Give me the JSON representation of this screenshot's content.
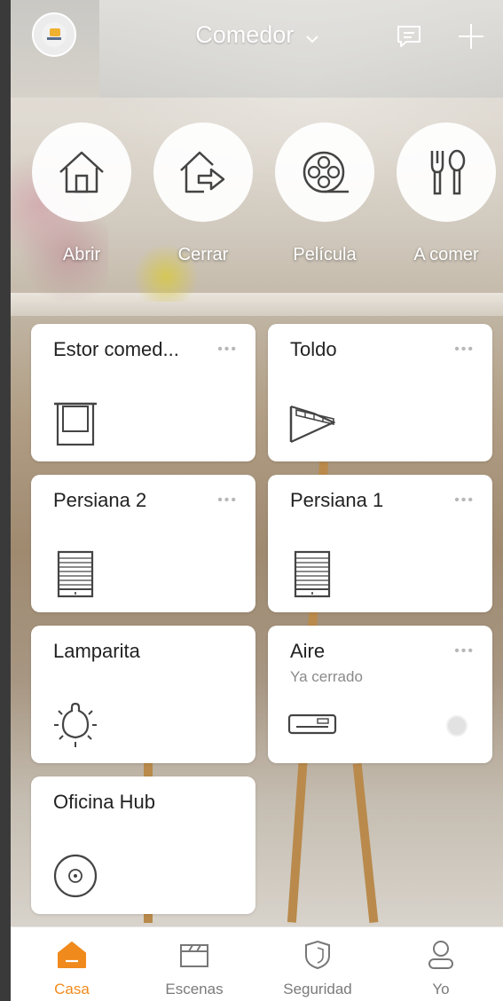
{
  "header": {
    "title": "Comedor",
    "avatar_icon": "home-brand-avatar",
    "message_icon": "message-icon",
    "add_icon": "plus-icon"
  },
  "scenes": [
    {
      "label": "Abrir",
      "icon": "house-icon"
    },
    {
      "label": "Cerrar",
      "icon": "house-exit-icon"
    },
    {
      "label": "Película",
      "icon": "film-reel-icon"
    },
    {
      "label": "A comer",
      "icon": "fork-spoon-icon"
    }
  ],
  "devices": [
    {
      "name": "Estor comed...",
      "subtitle": "",
      "more": "•••",
      "icon": "roller-blind-icon"
    },
    {
      "name": "Toldo",
      "subtitle": "",
      "more": "•••",
      "icon": "awning-icon"
    },
    {
      "name": "Persiana 2",
      "subtitle": "",
      "more": "•••",
      "icon": "shutter-icon"
    },
    {
      "name": "Persiana 1",
      "subtitle": "",
      "more": "•••",
      "icon": "shutter-icon"
    },
    {
      "name": "Lamparita",
      "subtitle": "",
      "more": "",
      "icon": "bulb-icon"
    },
    {
      "name": "Aire",
      "subtitle": "Ya cerrado",
      "more": "•••",
      "icon": "air-conditioner-icon"
    },
    {
      "name": "Oficina Hub",
      "subtitle": "",
      "more": "",
      "icon": "hub-icon"
    }
  ],
  "tabbar": [
    {
      "label": "Casa",
      "icon": "home-tab-icon",
      "active": true
    },
    {
      "label": "Escenas",
      "icon": "scenes-tab-icon",
      "active": false
    },
    {
      "label": "Seguridad",
      "icon": "shield-icon",
      "active": false
    },
    {
      "label": "Yo",
      "icon": "user-icon",
      "active": false
    }
  ],
  "colors": {
    "accent": "#f08a1c",
    "card": "#ffffff",
    "muted": "#7a7a7a"
  }
}
